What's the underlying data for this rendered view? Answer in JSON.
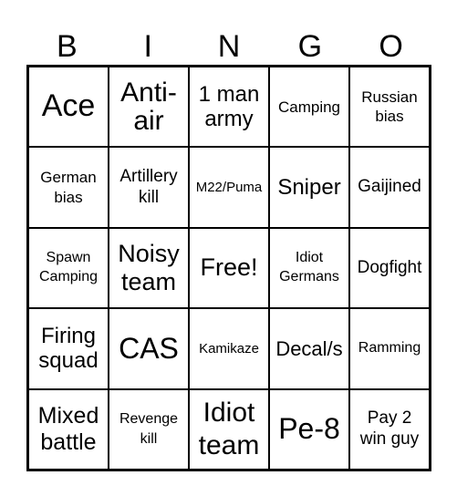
{
  "header": [
    "B",
    "I",
    "N",
    "G",
    "O"
  ],
  "cells": [
    [
      "Ace",
      "Anti-air",
      "1 man army",
      "Camping",
      "Russian bias"
    ],
    [
      "German bias",
      "Artillery kill",
      "M22/Puma",
      "Sniper",
      "Gaijined"
    ],
    [
      "Spawn Camping",
      "Noisy team",
      "Free!",
      "Idiot Germans",
      "Dogfight"
    ],
    [
      "Firing squad",
      "CAS",
      "Kamikaze",
      "Decal/s",
      "Ramming"
    ],
    [
      "Mixed battle",
      "Revenge kill",
      "Idiot team",
      "Pe-8",
      "Pay 2 win guy"
    ]
  ]
}
